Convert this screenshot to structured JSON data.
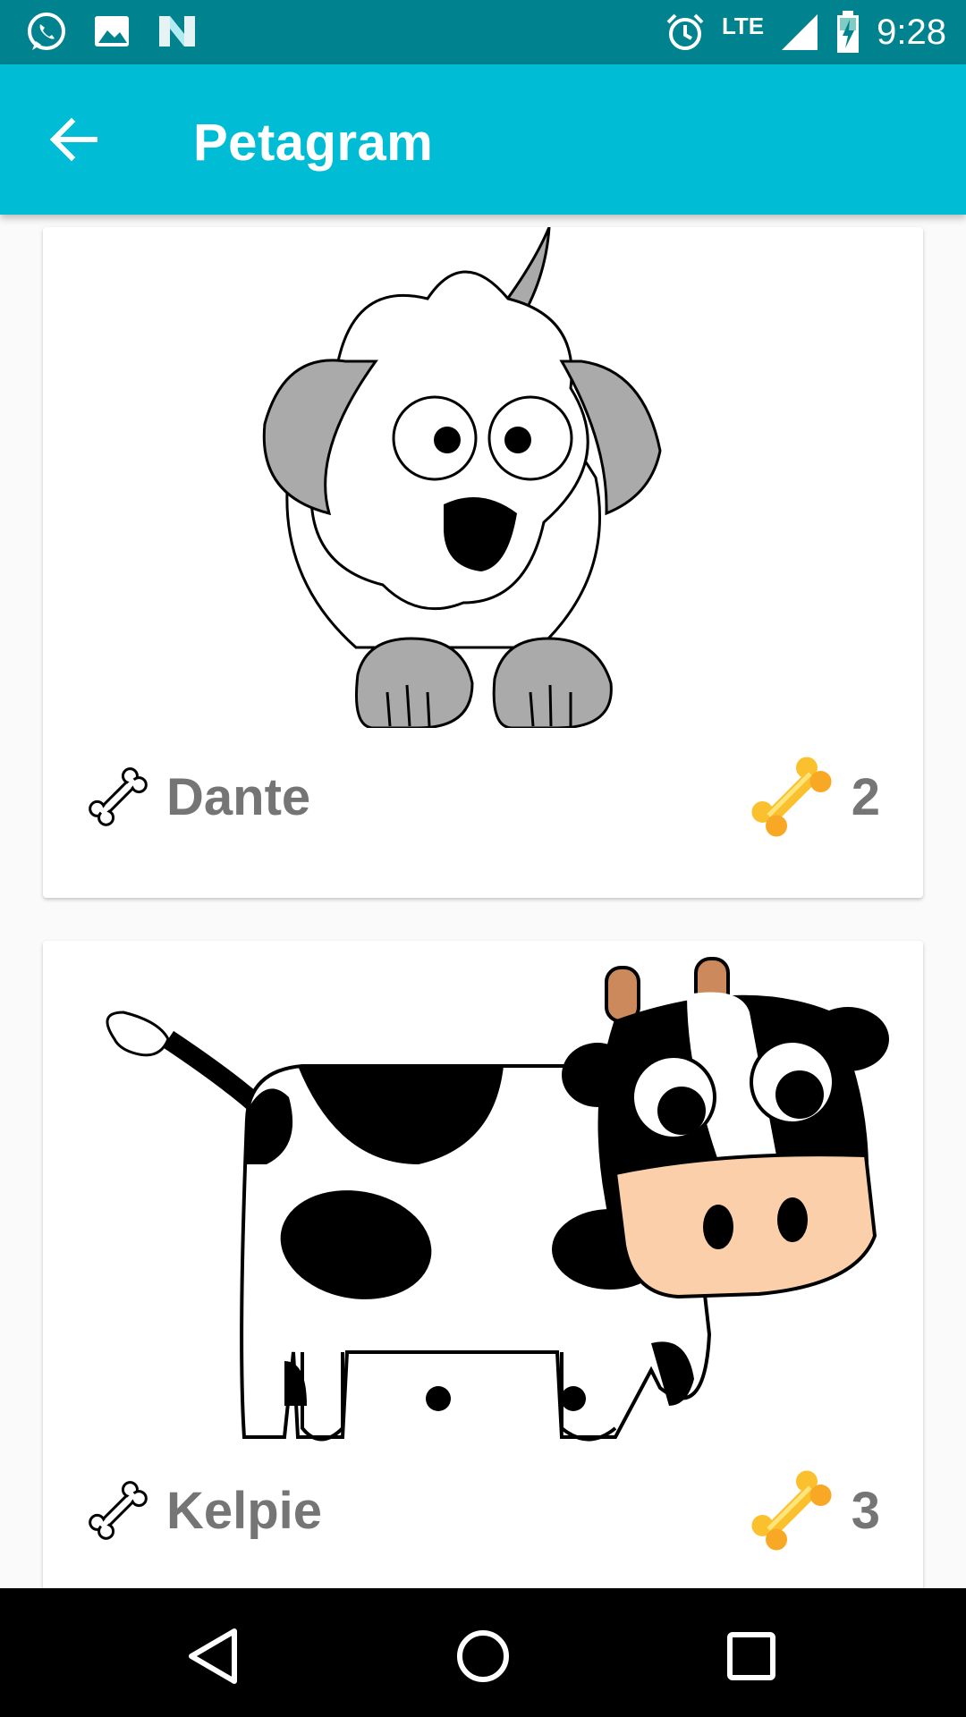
{
  "status_bar": {
    "time": "9:28",
    "network": "LTE",
    "left_icons": [
      "whatsapp-icon",
      "image-icon",
      "n-app-icon"
    ],
    "right_icons": [
      "alarm-icon",
      "signal-icon",
      "battery-charging-icon"
    ]
  },
  "app_bar": {
    "title": "Petagram",
    "back_icon": "arrow-left-icon",
    "background": "#00bcd4"
  },
  "pets": [
    {
      "name": "Dante",
      "rating": "2",
      "picture": "cartoon-dog"
    },
    {
      "name": "Kelpie",
      "rating": "3",
      "picture": "cartoon-cow"
    }
  ],
  "nav_bar": {
    "buttons": [
      "back-triangle-icon",
      "home-circle-icon",
      "recents-square-icon"
    ]
  },
  "colors": {
    "status_bar": "#00838f",
    "accent": "#00bcd4",
    "name_text": "#757575",
    "bone_gold": "#fbc02d"
  }
}
